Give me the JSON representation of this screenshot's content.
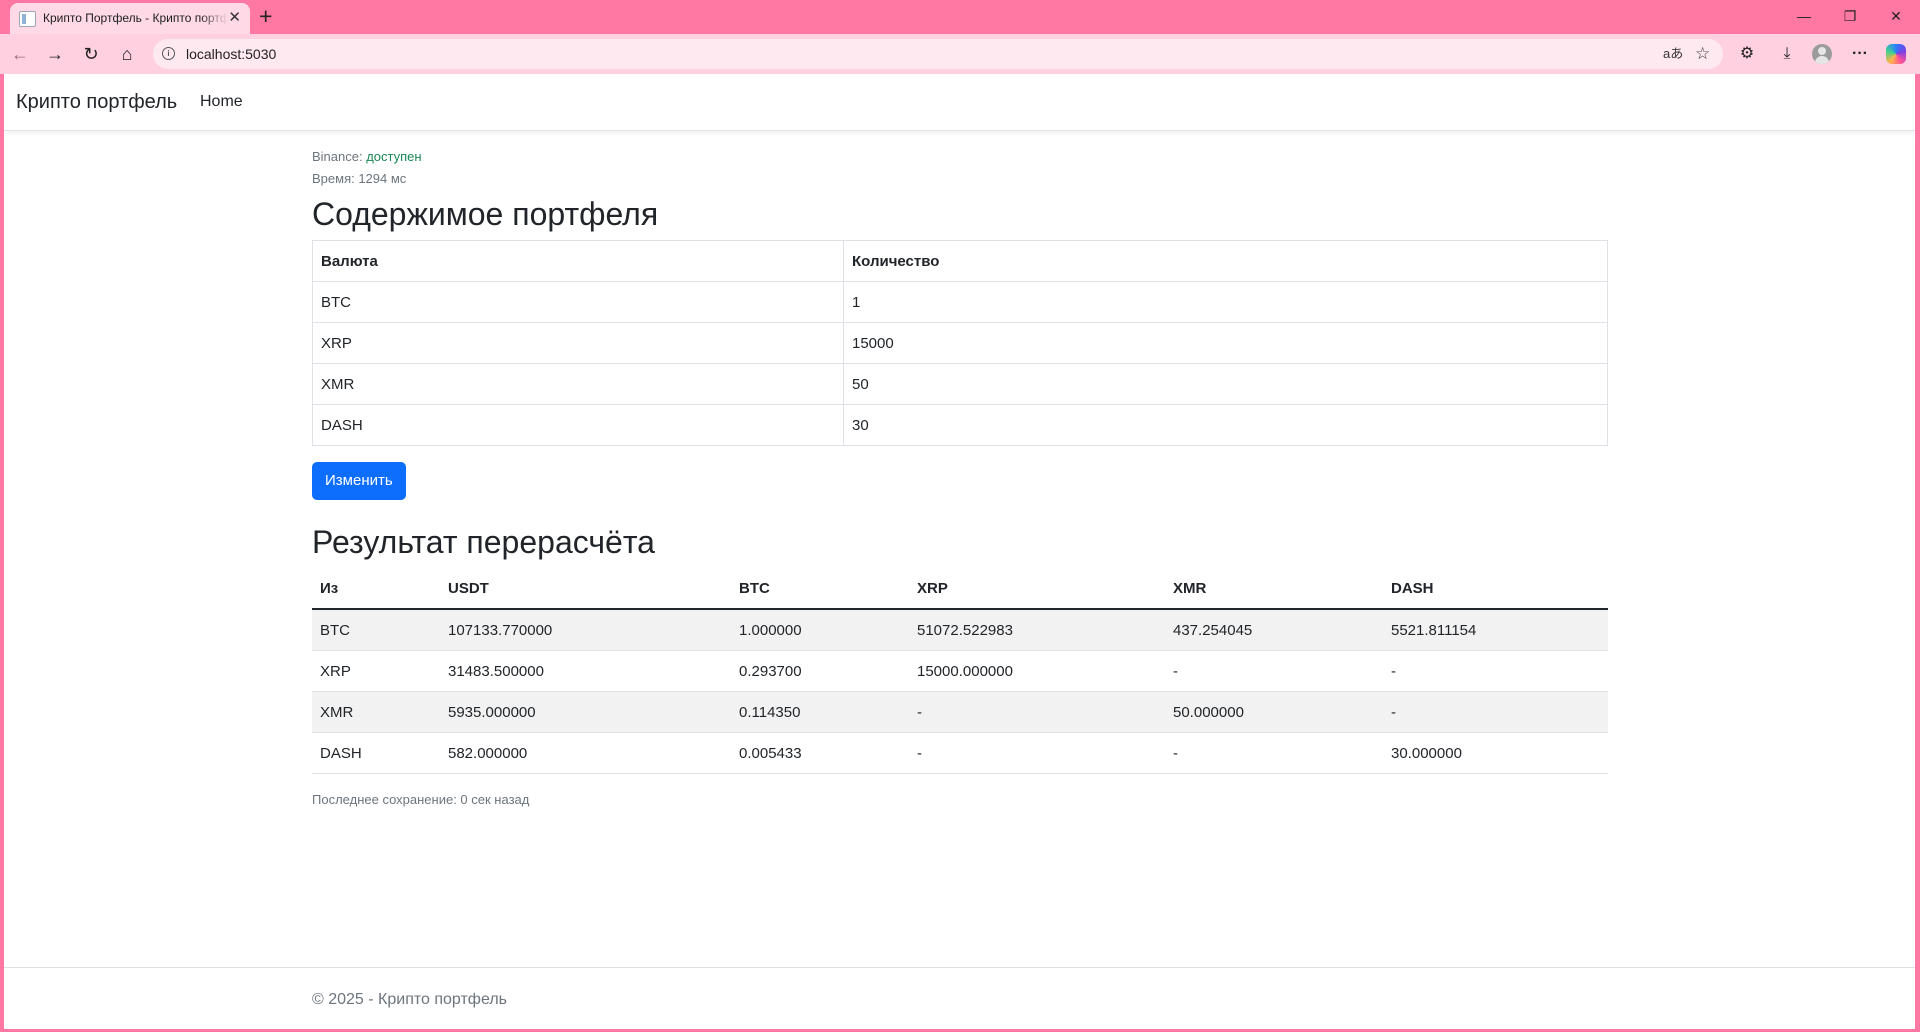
{
  "browser": {
    "tab_title": "Крипто Портфель - Крипто портфель",
    "tab_close": "✕",
    "new_tab": "+",
    "url": "localhost:5030",
    "controls": {
      "minimize": "—",
      "restore": "❐",
      "close": "✕"
    },
    "icons": {
      "back": "←",
      "forward": "→",
      "reload": "↻",
      "home": "⌂",
      "read_aloud": "aあ",
      "favorite": "☆",
      "extensions": "⚙",
      "downloads": "⤓",
      "menu": "···"
    }
  },
  "navbar": {
    "brand": "Крипто портфель",
    "home_link": "Home"
  },
  "status": {
    "binance_label": "Binance:",
    "binance_value": "доступен",
    "time_text": "Время: 1294 мс"
  },
  "portfolio": {
    "title": "Содержимое портфеля",
    "columns": [
      "Валюта",
      "Количество"
    ],
    "rows": [
      [
        "BTC",
        "1"
      ],
      [
        "XRP",
        "15000"
      ],
      [
        "XMR",
        "50"
      ],
      [
        "DASH",
        "30"
      ]
    ],
    "edit_button": "Изменить"
  },
  "results": {
    "title": "Результат перерасчёта",
    "columns": [
      "Из",
      "USDT",
      "BTC",
      "XRP",
      "XMR",
      "DASH"
    ],
    "rows": [
      [
        "BTC",
        "107133.770000",
        "1.000000",
        "51072.522983",
        "437.254045",
        "5521.811154"
      ],
      [
        "XRP",
        "31483.500000",
        "0.293700",
        "15000.000000",
        "-",
        "-"
      ],
      [
        "XMR",
        "5935.000000",
        "0.114350",
        "-",
        "50.000000",
        "-"
      ],
      [
        "DASH",
        "582.000000",
        "0.005433",
        "-",
        "-",
        "30.000000"
      ]
    ]
  },
  "last_saved": "Последнее сохранение: 0 сек назад",
  "footer": "© 2025 - Крипто портфель"
}
